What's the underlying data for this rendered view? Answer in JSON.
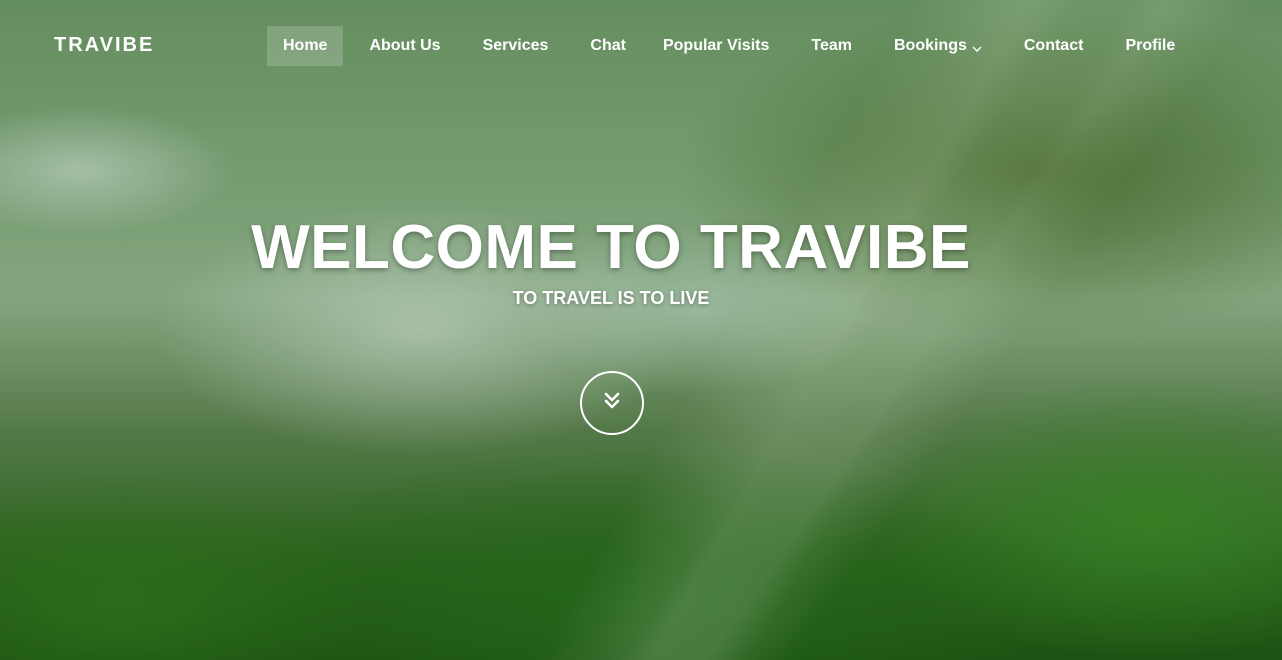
{
  "brand": {
    "logo_text": "TRAVIBE"
  },
  "nav": {
    "items": [
      {
        "label": "Home",
        "active": true
      },
      {
        "label": "About Us"
      },
      {
        "label": "Services"
      },
      {
        "label": "Chat"
      },
      {
        "label": "Popular Visits"
      },
      {
        "label": "Team"
      },
      {
        "label": "Bookings",
        "has_dropdown": true,
        "icon": "chevron-down-icon"
      },
      {
        "label": "Contact"
      },
      {
        "label": "Profile"
      }
    ]
  },
  "hero": {
    "title": "WELCOME TO TRAVIBE",
    "subtitle": "TO TRAVEL IS TO LIVE",
    "scroll_icon": "double-chevron-down-icon"
  },
  "colors": {
    "text": "#ffffff",
    "active_nav_bg": "rgba(255,255,255,0.18)",
    "foliage": "#2f6b1f",
    "mist": "#8fb48a"
  }
}
